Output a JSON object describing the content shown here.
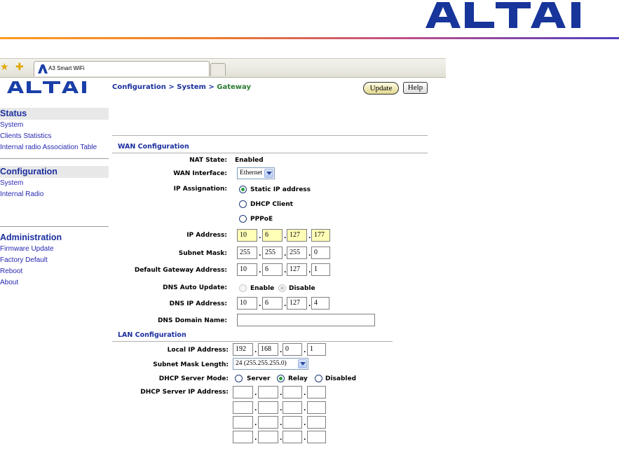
{
  "doc_logo": "ALTAI",
  "browser": {
    "tab_title": "A3 Smart WiFi"
  },
  "nav": {
    "logo": "ALTAI",
    "status": {
      "title": "Status",
      "items": [
        "System",
        "Clients Statistics",
        "Internal radio Association Table"
      ]
    },
    "configuration": {
      "title": "Configuration",
      "items": [
        "System",
        "Internal Radio"
      ]
    },
    "administration": {
      "title": "Administration",
      "items": [
        "Firmware Update",
        "Factory Default",
        "Reboot",
        "About"
      ]
    }
  },
  "header": {
    "crumb_1": "Configuration",
    "sep_1": ">",
    "crumb_2": "System",
    "sep_2": ">",
    "crumb_3": "Gateway",
    "update_label": "Update",
    "help_label": "Help"
  },
  "wan": {
    "title": "WAN Configuration",
    "nat_label": "NAT State:",
    "nat_value": "Enabled",
    "interface_label": "WAN Interface:",
    "interface_value": "Ethernet",
    "ip_assign_label": "IP Assignation:",
    "ip_assign_options": [
      "Static IP address",
      "DHCP Client",
      "PPPoE"
    ],
    "ip_label": "IP Address:",
    "ip": [
      "10",
      "6",
      "127",
      "177"
    ],
    "mask_label": "Subnet Mask:",
    "mask": [
      "255",
      "255",
      "255",
      "0"
    ],
    "gw_label": "Default Gateway Address:",
    "gw": [
      "10",
      "6",
      "127",
      "1"
    ],
    "dns_auto_label": "DNS Auto Update:",
    "dns_auto_options": [
      "Enable",
      "Disable"
    ],
    "dns_ip_label": "DNS IP Address:",
    "dns_ip": [
      "10",
      "6",
      "127",
      "4"
    ],
    "dns_domain_label": "DNS Domain Name:",
    "dns_domain_value": ""
  },
  "lan": {
    "title": "LAN Configuration",
    "local_ip_label": "Local IP Address:",
    "local_ip": [
      "192",
      "168",
      "0",
      "1"
    ],
    "mask_len_label": "Subnet Mask Length:",
    "mask_len_value": "24 (255.255.255.0)",
    "dhcp_mode_label": "DHCP Server Mode:",
    "dhcp_mode_options": [
      "Server",
      "Relay",
      "Disabled"
    ],
    "dhcp_server_ip_label": "DHCP Server IP Address:"
  },
  "colors": {
    "nav_heading": "#1b2f9e",
    "nav_link": "#2828b4",
    "crumb_current": "#2b7d32",
    "highlight_field": "#ffffb8"
  }
}
